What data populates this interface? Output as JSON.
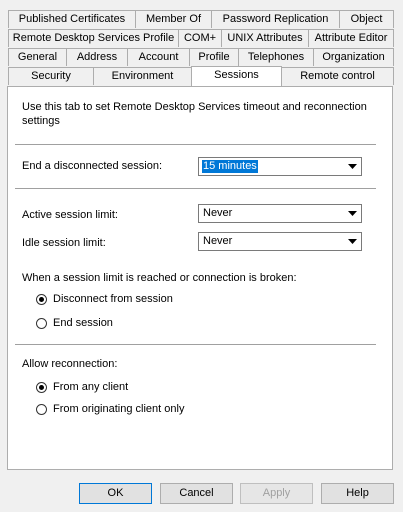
{
  "tabs": {
    "row1": [
      "Published Certificates",
      "Member Of",
      "Password Replication",
      "Object"
    ],
    "row2": [
      "Remote Desktop Services Profile",
      "COM+",
      "UNIX Attributes",
      "Attribute Editor"
    ],
    "row3": [
      "General",
      "Address",
      "Account",
      "Profile",
      "Telephones",
      "Organization"
    ],
    "row4": [
      "Security",
      "Environment",
      "Sessions",
      "Remote control"
    ],
    "selected": "Sessions"
  },
  "sessions": {
    "intro": "Use this tab to set Remote Desktop Services timeout and reconnection settings",
    "end_disconnected_label": "End a disconnected session:",
    "end_disconnected_value": "15 minutes",
    "active_limit_label": "Active session limit:",
    "active_limit_value": "Never",
    "idle_limit_label": "Idle session limit:",
    "idle_limit_value": "Never",
    "limit_reached_label": "When a session limit is reached or connection is broken:",
    "limit_options": [
      "Disconnect from session",
      "End session"
    ],
    "limit_selected": 0,
    "reconnection_label": "Allow reconnection:",
    "reconnection_options": [
      "From any client",
      "From originating client only"
    ],
    "reconnection_selected": 0
  },
  "buttons": {
    "ok": "OK",
    "cancel": "Cancel",
    "apply": "Apply",
    "help": "Help"
  }
}
